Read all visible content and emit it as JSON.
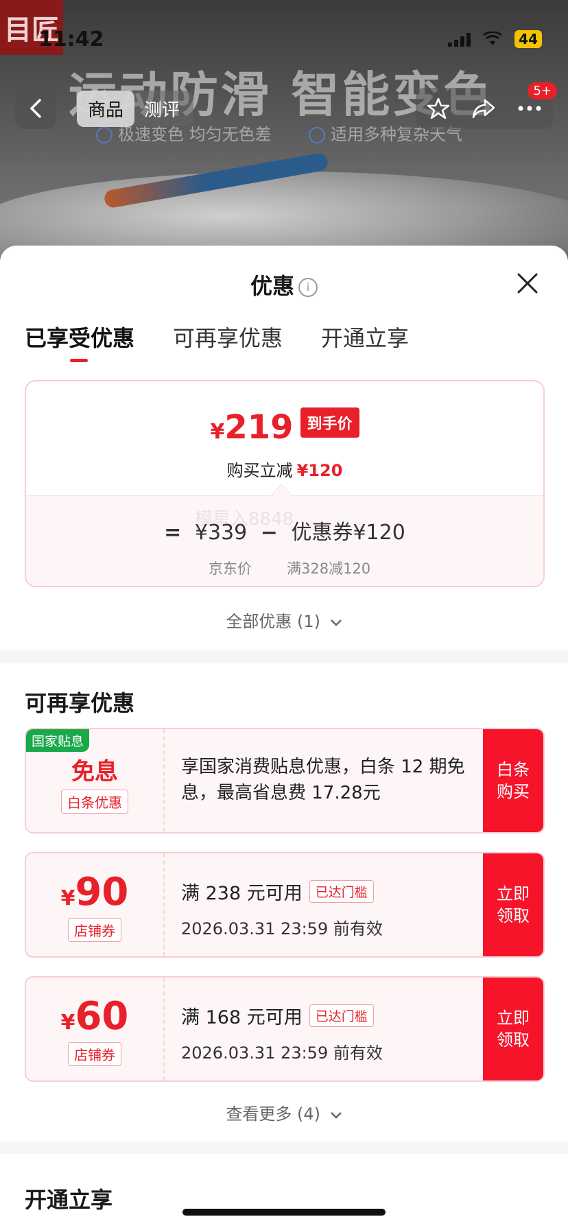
{
  "status_bar": {
    "time": "11:42",
    "battery": "44"
  },
  "hero": {
    "logo_text": "目匠",
    "slogan": "运动防滑 智能变色",
    "bullets": [
      "极速变色 均匀无色差",
      "适用多种复杂天气"
    ]
  },
  "navbar": {
    "tabs": [
      {
        "label": "商品",
        "active": true
      },
      {
        "label": "测评",
        "active": false
      }
    ],
    "badge": "5+",
    "icons": [
      "back-icon",
      "star-icon",
      "share-icon",
      "more-icon"
    ]
  },
  "sheet": {
    "title": "优惠",
    "tabs": [
      {
        "label": "已享受优惠",
        "active": true
      },
      {
        "label": "可再享优惠",
        "active": false
      },
      {
        "label": "开通立享",
        "active": false
      }
    ]
  },
  "price_card": {
    "yen": "¥",
    "final_price": "219",
    "tag": "到手价",
    "save_label": "购买立减",
    "save_amount": "¥120",
    "formula": {
      "eq": "=",
      "jd_price": "¥339",
      "minus": "−",
      "coupon": "优惠券¥120"
    },
    "jd_price_label": "京东价",
    "coupon_rule": "满328减120",
    "watermark": "模星入8848"
  },
  "all_offers": "全部优惠 (1)",
  "more_section": {
    "title": "可再享优惠",
    "coupons": [
      {
        "flag": "国家贴息",
        "big": "免息",
        "sublabel": "白条优惠",
        "text": "享国家消费贴息优惠，白条 12 期免息，最高省息费 17.28元",
        "action": "白条购买"
      },
      {
        "yen": "¥",
        "amount": "90",
        "sublabel": "店铺券",
        "condition": "满 238 元可用",
        "reached": "已达门槛",
        "validity": "2026.03.31 23:59 前有效",
        "action": "立即领取"
      },
      {
        "yen": "¥",
        "amount": "60",
        "sublabel": "店铺券",
        "condition": "满 168 元可用",
        "reached": "已达门槛",
        "validity": "2026.03.31 23:59 前有效",
        "action": "立即领取"
      }
    ],
    "see_more": "查看更多 (4)"
  },
  "open_section": {
    "title": "开通立享"
  },
  "colors": {
    "accent_red": "#e8202a",
    "action_red": "#f5142a",
    "flag_green": "#1aa94a"
  }
}
